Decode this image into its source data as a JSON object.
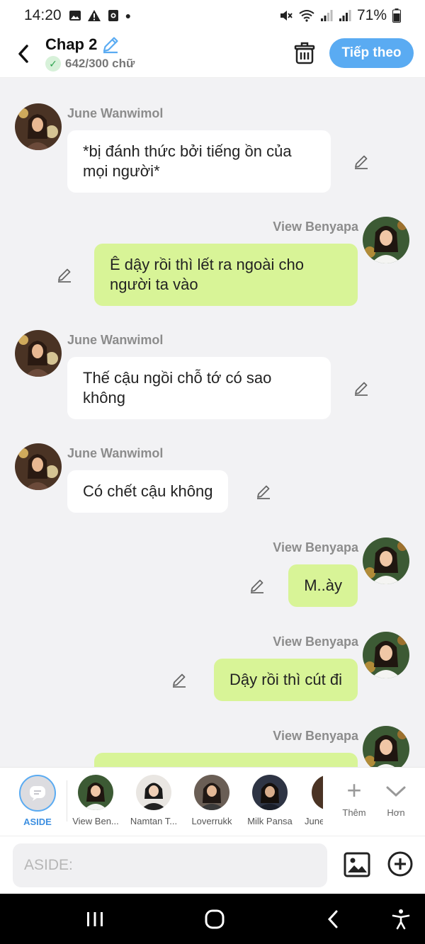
{
  "status_bar": {
    "time": "14:20",
    "left_icons": [
      "image-icon",
      "warning-icon",
      "screen-record-icon",
      "dot-icon"
    ],
    "battery": "71%",
    "right_icons": [
      "mute-icon",
      "wifi-icon",
      "signal-icon",
      "signal-icon",
      "battery-icon"
    ]
  },
  "header": {
    "title": "Chap 2",
    "word_count": "642/300 chữ",
    "next_label": "Tiếp theo",
    "colors": {
      "accent": "#5aabf2",
      "check": "#2ea44f"
    }
  },
  "messages": [
    {
      "sender": "June Wanwimol",
      "text": "*bị đánh thức bởi tiếng ồn của mọi người*",
      "side": "left"
    },
    {
      "sender": "View Benyapa",
      "text": "Ê dậy rồi thì lết ra ngoài cho người ta vào",
      "side": "right"
    },
    {
      "sender": "June Wanwimol",
      "text": "Thế cậu ngồi chỗ tớ có sao không",
      "side": "left"
    },
    {
      "sender": "June Wanwimol",
      "text": "Có chết cậu không",
      "side": "left"
    },
    {
      "sender": "View Benyapa",
      "text": "M..ày",
      "side": "right"
    },
    {
      "sender": "View Benyapa",
      "text": "Dậy rồi thì cút đi",
      "side": "right"
    },
    {
      "sender": "View Benyapa",
      "text": "",
      "side": "right"
    }
  ],
  "bubble_colors": {
    "left": "#ffffff",
    "right": "#d8f497"
  },
  "characters": {
    "aside": "ASIDE",
    "items": [
      "View Ben...",
      "Namtan T...",
      "Loverrukk",
      "Milk Pansa",
      "June"
    ],
    "add_label": "Thêm",
    "more_label": "Hơn"
  },
  "input": {
    "placeholder": "ASIDE:"
  }
}
